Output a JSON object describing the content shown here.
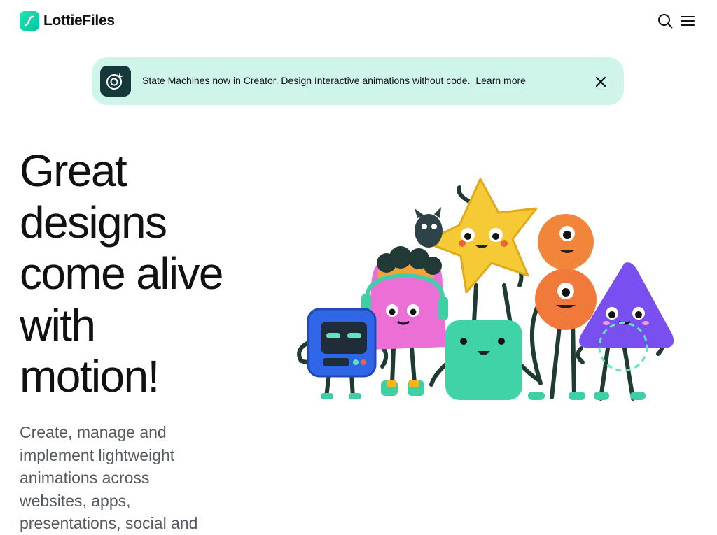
{
  "header": {
    "brand_name": "LottieFiles",
    "logo_icon": "lottie-logo-icon",
    "search_icon": "search-icon",
    "menu_icon": "hamburger-menu-icon"
  },
  "banner": {
    "icon": "state-machine-icon",
    "message": "State Machines now in Creator. Design Interactive animations without code.",
    "link_label": "Learn more",
    "close_icon": "close-icon",
    "background": "#cff5ea"
  },
  "hero": {
    "title_lines": [
      "Great",
      "designs",
      "come alive",
      "with",
      "motion!"
    ],
    "subtitle_lines": [
      "Create, manage and",
      "implement lightweight",
      "animations across",
      "websites, apps,",
      "presentations, social and"
    ]
  },
  "illustration": {
    "characters": [
      "robot-character",
      "pink-blob-character",
      "black-cat-character",
      "star-character",
      "green-square-character",
      "orange-circle-top-character",
      "orange-circle-bottom-character",
      "purple-triangle-character"
    ]
  },
  "colors": {
    "brand_accent": "#00ddb3",
    "text_primary": "#111111",
    "text_secondary": "#555a60"
  }
}
